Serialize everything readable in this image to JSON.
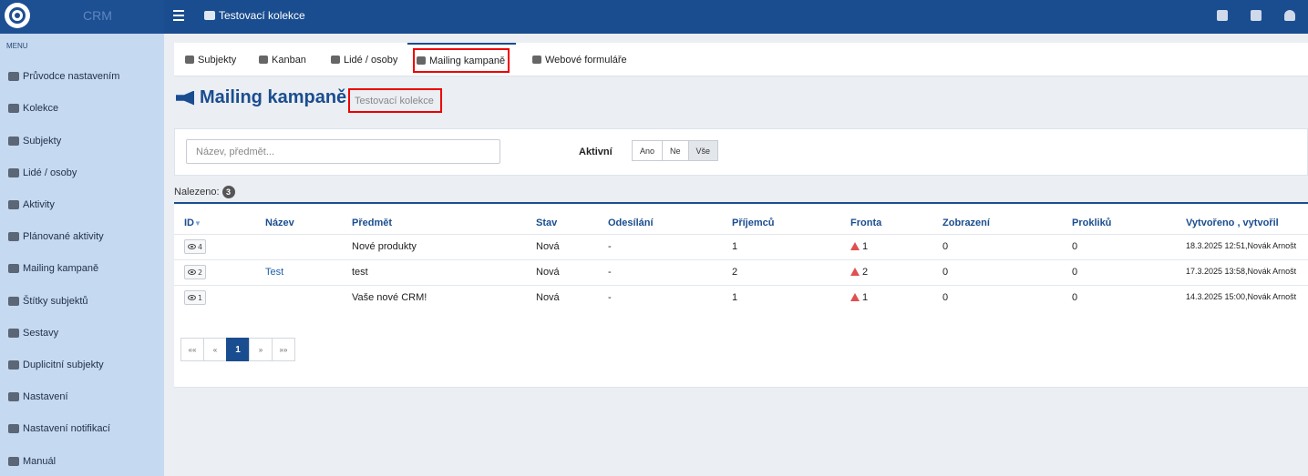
{
  "app": {
    "brand": "CRM",
    "title": "Testovací kolekce"
  },
  "sidebar": {
    "menu_label": "MENU",
    "items": [
      {
        "label": "Průvodce nastavením",
        "icon": "pencil-icon"
      },
      {
        "label": "Kolekce",
        "icon": "collection-icon"
      },
      {
        "label": "Subjekty",
        "icon": "building-icon"
      },
      {
        "label": "Lidé / osoby",
        "icon": "person-icon"
      },
      {
        "label": "Aktivity",
        "icon": "chat-icon"
      },
      {
        "label": "Plánované aktivity",
        "icon": "comment-icon"
      },
      {
        "label": "Mailing kampaně",
        "icon": "megaphone-icon"
      },
      {
        "label": "Štítky subjektů",
        "icon": "tag-icon"
      },
      {
        "label": "Sestavy",
        "icon": "report-icon"
      },
      {
        "label": "Duplicitní subjekty",
        "icon": "duplicate-icon"
      },
      {
        "label": "Nastavení",
        "icon": "gears-icon"
      },
      {
        "label": "Nastavení notifikací",
        "icon": "bell-icon"
      },
      {
        "label": "Manuál",
        "icon": "book-icon"
      }
    ]
  },
  "tabs": [
    {
      "label": "Subjekty"
    },
    {
      "label": "Kanban"
    },
    {
      "label": "Lidé / osoby"
    },
    {
      "label": "Mailing kampaně"
    },
    {
      "label": "Webové formuláře"
    }
  ],
  "page": {
    "title": "Mailing kampaně",
    "subtitle": "Testovací kolekce"
  },
  "filter": {
    "search_placeholder": "Název, předmět...",
    "active_label": "Aktivní",
    "options": [
      "Ano",
      "Ne",
      "Vše"
    ],
    "selected": "Vše"
  },
  "found": {
    "label": "Nalezeno:",
    "count": "3"
  },
  "table": {
    "headers": [
      "ID",
      "Název",
      "Předmět",
      "Stav",
      "Odesílání",
      "Příjemců",
      "Fronta",
      "Zobrazení",
      "Prokliků",
      "Vytvořeno , vytvořil"
    ],
    "rows": [
      {
        "id": "4",
        "name": "",
        "subject": "Nové produkty",
        "state": "Nová",
        "sending": "-",
        "recipients": "1",
        "queue": "1",
        "views": "0",
        "clicks": "0",
        "created": "18.3.2025 12:51,Novák Arnošt"
      },
      {
        "id": "2",
        "name": "Test",
        "subject": "test",
        "state": "Nová",
        "sending": "-",
        "recipients": "2",
        "queue": "2",
        "views": "0",
        "clicks": "0",
        "created": "17.3.2025 13:58,Novák Arnošt"
      },
      {
        "id": "1",
        "name": "",
        "subject": "Vaše nové CRM!",
        "state": "Nová",
        "sending": "-",
        "recipients": "1",
        "queue": "1",
        "views": "0",
        "clicks": "0",
        "created": "14.3.2025 15:00,Novák Arnošt"
      }
    ]
  },
  "pagination": {
    "first": "««",
    "prev": "«",
    "current": "1",
    "next": "»",
    "last": "»»"
  },
  "colors": {
    "primary": "#1a4d8f",
    "sidebar": "#c5d9f1",
    "highlight": "#e00000",
    "warning": "#e05050"
  }
}
